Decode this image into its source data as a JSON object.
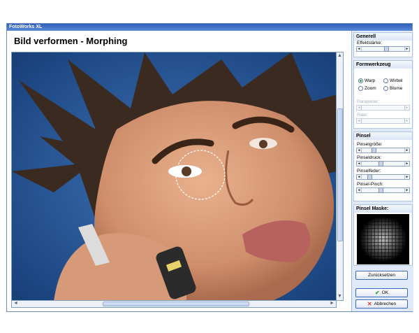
{
  "window": {
    "title": "FotoWorks XL"
  },
  "main": {
    "title": "Bild verformen - Morphing"
  },
  "icons": {
    "scroll_left": "◄",
    "scroll_right": "►",
    "scroll_up": "▲",
    "scroll_down": "▼",
    "slider_left": "◄",
    "slider_right": "►",
    "ok": "✔",
    "cancel": "✕"
  },
  "panels": {
    "generell": {
      "title": "Generell",
      "effektstaerke_label": "Effektstärke:",
      "effektstaerke_value": 0.6
    },
    "formwerkzeug": {
      "title": "Formwerkzeug",
      "options": [
        {
          "label": "Warp",
          "selected": true
        },
        {
          "label": "Wirbel",
          "selected": false
        },
        {
          "label": "Zoom",
          "selected": false
        },
        {
          "label": "Blume",
          "selected": false
        }
      ],
      "parameter_label": "Parameter:",
      "rate_label": "Rate:"
    },
    "pinsel": {
      "title": "Pinsel",
      "sliders": [
        {
          "label": "Pinselgröße:",
          "value": 0.25
        },
        {
          "label": "Pinseldruck:",
          "value": 0.45
        },
        {
          "label": "Pinselfeder:",
          "value": 0.15
        },
        {
          "label": "Pinsel-Pinch:",
          "value": 0.45
        }
      ]
    },
    "maske": {
      "title": "Pinsel Maske:"
    }
  },
  "buttons": {
    "reset": "Zurücksetzen",
    "ok": "OK",
    "cancel": "Abbrechen"
  },
  "colors": {
    "title_bar": "#3b6cc4",
    "ok_check": "#2ea52e",
    "cancel_x": "#d23a2a"
  }
}
